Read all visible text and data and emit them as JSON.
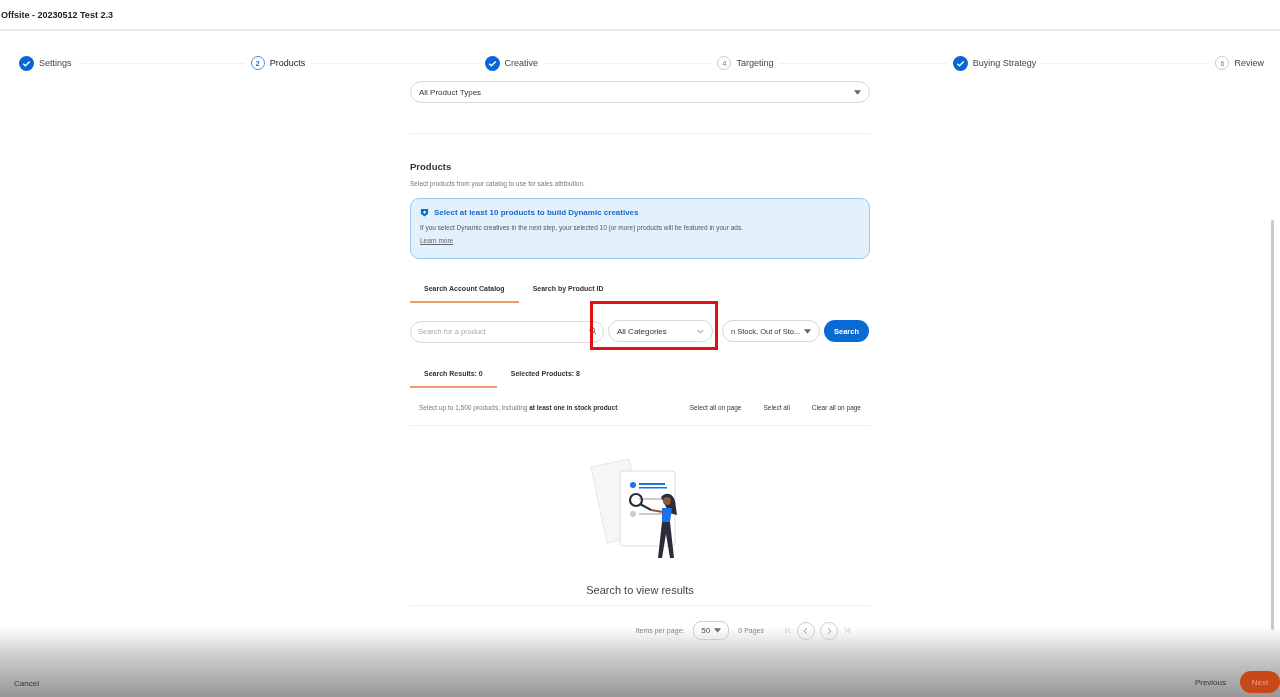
{
  "header": {
    "title": "Offsite - 20230512 Test 2.3"
  },
  "steps": [
    {
      "label": "Settings",
      "done": true
    },
    {
      "label": "Products",
      "done": false,
      "current": true,
      "number": "2"
    },
    {
      "label": "Creative",
      "done": true
    },
    {
      "label": "Targeting",
      "done": false,
      "current": false,
      "number": "4"
    },
    {
      "label": "Buying Strategy",
      "done": true
    },
    {
      "label": "Review",
      "done": false,
      "current": false,
      "number": "6"
    }
  ],
  "product_type_select": {
    "value": "All Product Types"
  },
  "products": {
    "heading": "Products",
    "description": "Select products from your catalog to use for sales attribution.",
    "notice": {
      "title": "Select at least 10 products to build Dynamic creatives",
      "text": "If you select Dynamic creatives in the next step, your selected 10 (or more) products will be featured in your ads.",
      "link": "Learn more"
    },
    "search_tabs": [
      {
        "label": "Search Account Catalog",
        "selected": true
      },
      {
        "label": "Search by Product ID",
        "selected": false
      }
    ],
    "search_field": {
      "placeholder": "Search for a product"
    },
    "category_select": {
      "value": "All Categories",
      "highlighted": true
    },
    "stock_select": {
      "value": "n Stock, Out of Sto..."
    },
    "search_button": "Search",
    "result_tabs": [
      {
        "label": "Search Results: 0",
        "selected": true
      },
      {
        "label": "Selected Products: 8",
        "selected": false
      }
    ],
    "selection_note": "Select up to 1,500 products, including **at least one in stock product**",
    "selection_actions": [
      "Select all on page",
      "Select all",
      "Clear all on page"
    ],
    "empty_message": "Search to view results",
    "pagination": {
      "items_label": "Items per page:",
      "per_page": "50",
      "pages": "0 Pages"
    }
  },
  "footer": {
    "cancel": "Cancel",
    "previous": "Previous",
    "next": "Next"
  }
}
